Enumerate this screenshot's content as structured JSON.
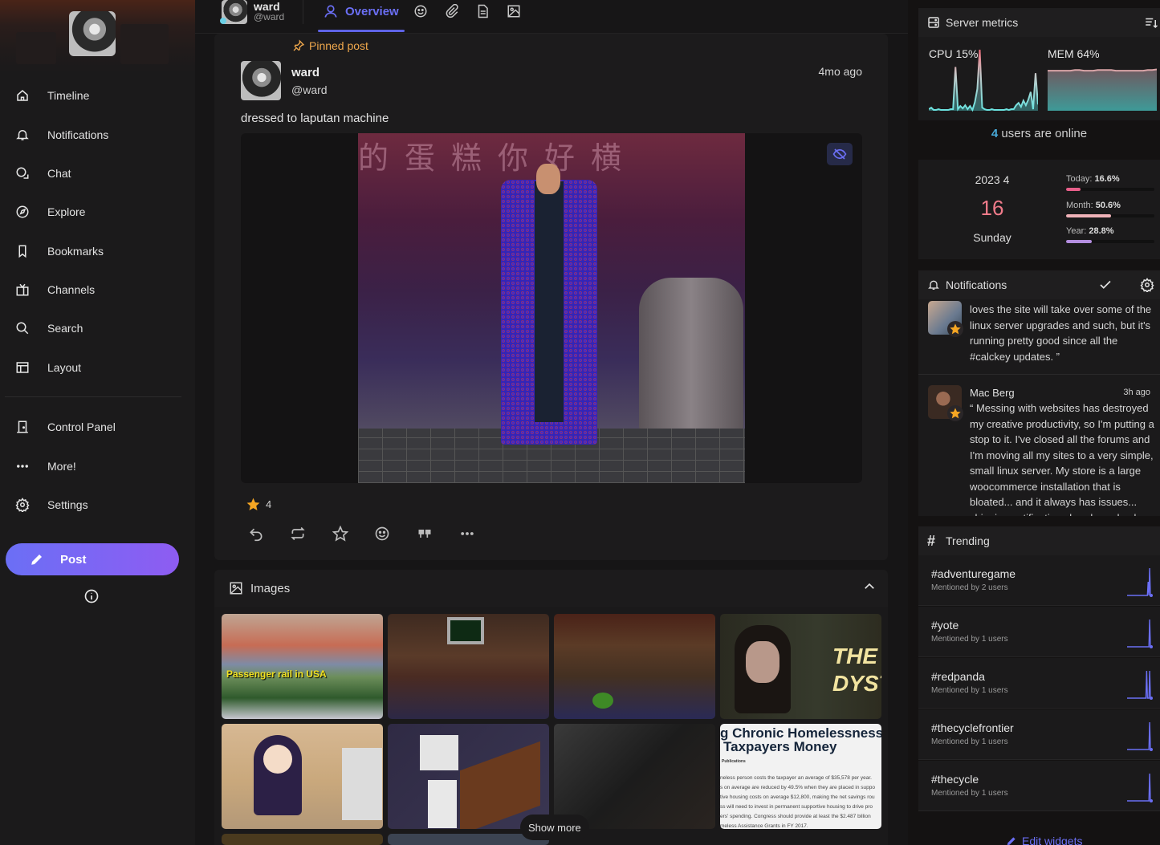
{
  "nav": {
    "items": [
      {
        "label": "Timeline",
        "icon": "home-icon"
      },
      {
        "label": "Notifications",
        "icon": "bell-icon"
      },
      {
        "label": "Chat",
        "icon": "chat-icon"
      },
      {
        "label": "Explore",
        "icon": "compass-icon"
      },
      {
        "label": "Bookmarks",
        "icon": "bookmark-icon"
      },
      {
        "label": "Channels",
        "icon": "tv-icon"
      },
      {
        "label": "Search",
        "icon": "search-icon"
      },
      {
        "label": "Layout",
        "icon": "layout-icon"
      }
    ],
    "secondary": [
      {
        "label": "Control Panel",
        "icon": "door-icon"
      },
      {
        "label": "More!",
        "icon": "dots-icon"
      },
      {
        "label": "Settings",
        "icon": "gear-icon"
      }
    ],
    "post_label": "Post"
  },
  "profile": {
    "name": "ward",
    "handle": "@ward",
    "tabs": [
      {
        "label": "Overview",
        "active": true,
        "icon": "user-icon"
      },
      {
        "label": "",
        "icon": "smile-icon"
      },
      {
        "label": "",
        "icon": "paperclip-icon"
      },
      {
        "label": "",
        "icon": "file-icon"
      },
      {
        "label": "",
        "icon": "image-icon"
      }
    ]
  },
  "post": {
    "pinned_label": "Pinned post",
    "author_name": "ward",
    "author_handle": "@ward",
    "time": "4mo ago",
    "text": "dressed to laputan machine",
    "image_alt": "3D game character in a long blue-red coat and sunglasses standing in a neon-lit alley",
    "reaction_count": "4",
    "accent": "#6b6ff5"
  },
  "images_panel": {
    "title": "Images",
    "show_more": "Show more",
    "thumbs": [
      {
        "caption": "Passenger rail in USA"
      },
      {
        "caption": ""
      },
      {
        "caption": ""
      },
      {
        "caption": "THE A DYSTOPIA"
      },
      {
        "caption": ""
      },
      {
        "caption": ""
      },
      {
        "caption": ""
      },
      {
        "caption": "g Chronic Homelessness Taxpayers Money"
      }
    ],
    "article": {
      "heading1": "g Chronic Homelessness",
      "heading2": "Taxpayers Money",
      "source": "Publications",
      "lines": [
        "neless person costs the taxpayer an average of $35,578 per year.",
        "s on average are reduced by 49.5% when they are placed in suppo",
        "tive housing costs on average $12,800, making the net savings rou",
        "ss will need to invest in permanent supportive housing to drive pro",
        "ers' spending. Congress should provide at least the $2.487 billion",
        "meless Assistance Grants in FY 2017."
      ]
    }
  },
  "widgets": {
    "server_metrics": {
      "title": "Server metrics",
      "cpu_label": "CPU 15%",
      "mem_label": "MEM 64%",
      "cpu_series": [
        2,
        4,
        1,
        1,
        2,
        1,
        1,
        1,
        1,
        2,
        2,
        56,
        2,
        6,
        3,
        7,
        2,
        6,
        1,
        11,
        28,
        78,
        4,
        2,
        1,
        1,
        2,
        1,
        1,
        1,
        1,
        1,
        2,
        1,
        2,
        2,
        7,
        10,
        5,
        13,
        7,
        14,
        24,
        2,
        48,
        8
      ],
      "mem_series": [
        64,
        64,
        64,
        64,
        64,
        64,
        65,
        65,
        64,
        64,
        64,
        65,
        65,
        65,
        65,
        64,
        64,
        64,
        64,
        64,
        64,
        64,
        65,
        65,
        66
      ]
    },
    "online": {
      "count": "4",
      "text": " users are online"
    },
    "calendar": {
      "year_month": "2023 4",
      "day": "16",
      "weekday": "Sunday",
      "progress": [
        {
          "label": "Today:",
          "value": "16.6%",
          "fraction": 0.166,
          "color": "#e85f8a"
        },
        {
          "label": "Month:",
          "value": "50.6%",
          "fraction": 0.506,
          "color": "#f0b2b8"
        },
        {
          "label": "Year:",
          "value": "28.8%",
          "fraction": 0.288,
          "color": "#b48ee0"
        }
      ]
    },
    "notifications": {
      "title": "Notifications",
      "items": [
        {
          "name": "",
          "time": "",
          "text": "loves the site will take over some of the linux server upgrades and such, but it's running pretty good since all the #calckey updates. ”"
        },
        {
          "name": "Mac Berg",
          "time": "3h ago",
          "text": "“ Messing with websites has destroyed my creative productivity, so I'm putting a stop to it. I've closed all the forums and I'm moving all my sites to a very simple, small linux server. My store is a large woocommerce installation that is bloated... and it always has issues... shipping notifications break randomly"
        }
      ]
    },
    "trending": {
      "title": "Trending",
      "items": [
        {
          "tag": "#adventuregame",
          "sub": "Mentioned by 2 users",
          "spark": [
            0,
            0,
            0,
            0,
            0,
            0,
            0,
            0,
            0,
            0,
            0,
            0,
            0,
            0,
            0,
            0,
            0,
            0,
            0,
            0,
            0,
            0,
            0,
            0,
            0,
            0,
            0,
            0,
            1,
            0,
            2,
            0,
            0
          ]
        },
        {
          "tag": "#yote",
          "sub": "Mentioned by 1 users",
          "spark": [
            0,
            0,
            0,
            0,
            0,
            0,
            0,
            0,
            0,
            0,
            0,
            0,
            0,
            0,
            0,
            0,
            0,
            0,
            0,
            0,
            0,
            0,
            0,
            0,
            0,
            0,
            0,
            0,
            0,
            0,
            1,
            0,
            0
          ]
        },
        {
          "tag": "#redpanda",
          "sub": "Mentioned by 1 users",
          "spark": [
            0,
            0,
            0,
            0,
            0,
            0,
            0,
            0,
            0,
            0,
            0,
            0,
            0,
            0,
            0,
            0,
            0,
            0,
            0,
            0,
            0,
            0,
            0,
            0,
            0,
            0,
            1,
            0,
            0,
            0,
            1,
            0,
            0
          ]
        },
        {
          "tag": "#thecyclefrontier",
          "sub": "Mentioned by 1 users",
          "spark": [
            0,
            0,
            0,
            0,
            0,
            0,
            0,
            0,
            0,
            0,
            0,
            0,
            0,
            0,
            0,
            0,
            0,
            0,
            0,
            0,
            0,
            0,
            0,
            0,
            0,
            0,
            0,
            0,
            0,
            0,
            1,
            0,
            0
          ]
        },
        {
          "tag": "#thecycle",
          "sub": "Mentioned by 1 users",
          "spark": [
            0,
            0,
            0,
            0,
            0,
            0,
            0,
            0,
            0,
            0,
            0,
            0,
            0,
            0,
            0,
            0,
            0,
            0,
            0,
            0,
            0,
            0,
            0,
            0,
            0,
            0,
            0,
            0,
            0,
            0,
            1,
            0,
            0
          ]
        }
      ]
    },
    "edit_label": "Edit widgets"
  }
}
